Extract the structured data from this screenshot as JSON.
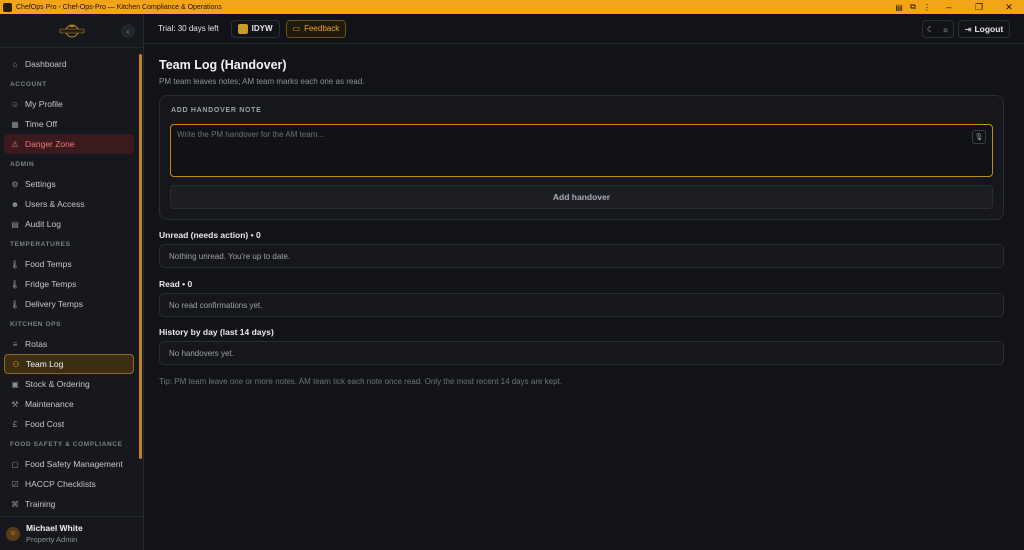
{
  "window": {
    "title": "ChefOps Pro - Chef-Ops-Pro — Kitchen Compliance & Operations",
    "icons": [
      "extensions-icon",
      "puzzle-icon",
      "more-icon"
    ],
    "controls": [
      "minimize",
      "maximize",
      "close"
    ]
  },
  "brand": {
    "accent": "#f2a516",
    "danger": "#f07a7a"
  },
  "sidebar": {
    "items": [
      {
        "type": "item",
        "label": "Dashboard",
        "icon": "home-icon"
      },
      {
        "type": "section",
        "label": "ACCOUNT"
      },
      {
        "type": "item",
        "label": "My Profile",
        "icon": "user-icon"
      },
      {
        "type": "item",
        "label": "Time Off",
        "icon": "calendar-icon"
      },
      {
        "type": "item",
        "label": "Danger Zone",
        "icon": "warning-icon",
        "state": "danger"
      },
      {
        "type": "section",
        "label": "ADMIN"
      },
      {
        "type": "item",
        "label": "Settings",
        "icon": "gear-icon"
      },
      {
        "type": "item",
        "label": "Users & Access",
        "icon": "users-icon"
      },
      {
        "type": "item",
        "label": "Audit Log",
        "icon": "clipboard-icon"
      },
      {
        "type": "section",
        "label": "TEMPERATURES"
      },
      {
        "type": "item",
        "label": "Food Temps",
        "icon": "thermometer-icon"
      },
      {
        "type": "item",
        "label": "Fridge Temps",
        "icon": "thermometer-icon"
      },
      {
        "type": "item",
        "label": "Delivery Temps",
        "icon": "thermometer-icon"
      },
      {
        "type": "section",
        "label": "KITCHEN OPS"
      },
      {
        "type": "item",
        "label": "Rotas",
        "icon": "list-icon"
      },
      {
        "type": "item",
        "label": "Team Log",
        "icon": "team-icon",
        "state": "active"
      },
      {
        "type": "item",
        "label": "Stock & Ordering",
        "icon": "box-icon"
      },
      {
        "type": "item",
        "label": "Maintenance",
        "icon": "wrench-icon"
      },
      {
        "type": "item",
        "label": "Food Cost",
        "icon": "pound-icon"
      },
      {
        "type": "section",
        "label": "FOOD SAFETY & COMPLIANCE"
      },
      {
        "type": "item",
        "label": "Food Safety Management",
        "icon": "document-icon"
      },
      {
        "type": "item",
        "label": "HACCP Checklists",
        "icon": "checklist-icon"
      },
      {
        "type": "item",
        "label": "Training",
        "icon": "graduation-icon"
      }
    ],
    "user": {
      "name": "Michael White",
      "role": "Property Admin"
    }
  },
  "topbar": {
    "trial": "Trial: 30 days left",
    "org": "IDYW",
    "feedback": "Feedback",
    "logout": "Logout"
  },
  "main": {
    "title": "Team Log (Handover)",
    "subtitle": "PM team leaves notes; AM team marks each one as read.",
    "add_card": {
      "heading": "ADD HANDOVER NOTE",
      "placeholder": "Write the PM handover for the AM team...",
      "button": "Add handover"
    },
    "sections": [
      {
        "title": "Unread (needs action) • 0",
        "empty": "Nothing unread. You're up to date."
      },
      {
        "title": "Read • 0",
        "empty": "No read confirmations yet."
      },
      {
        "title": "History by day (last 14 days)",
        "empty": "No handovers yet."
      }
    ],
    "tip": "Tip: PM team leave one or more notes. AM team tick each note once read. Only the most recent 14 days are kept."
  }
}
